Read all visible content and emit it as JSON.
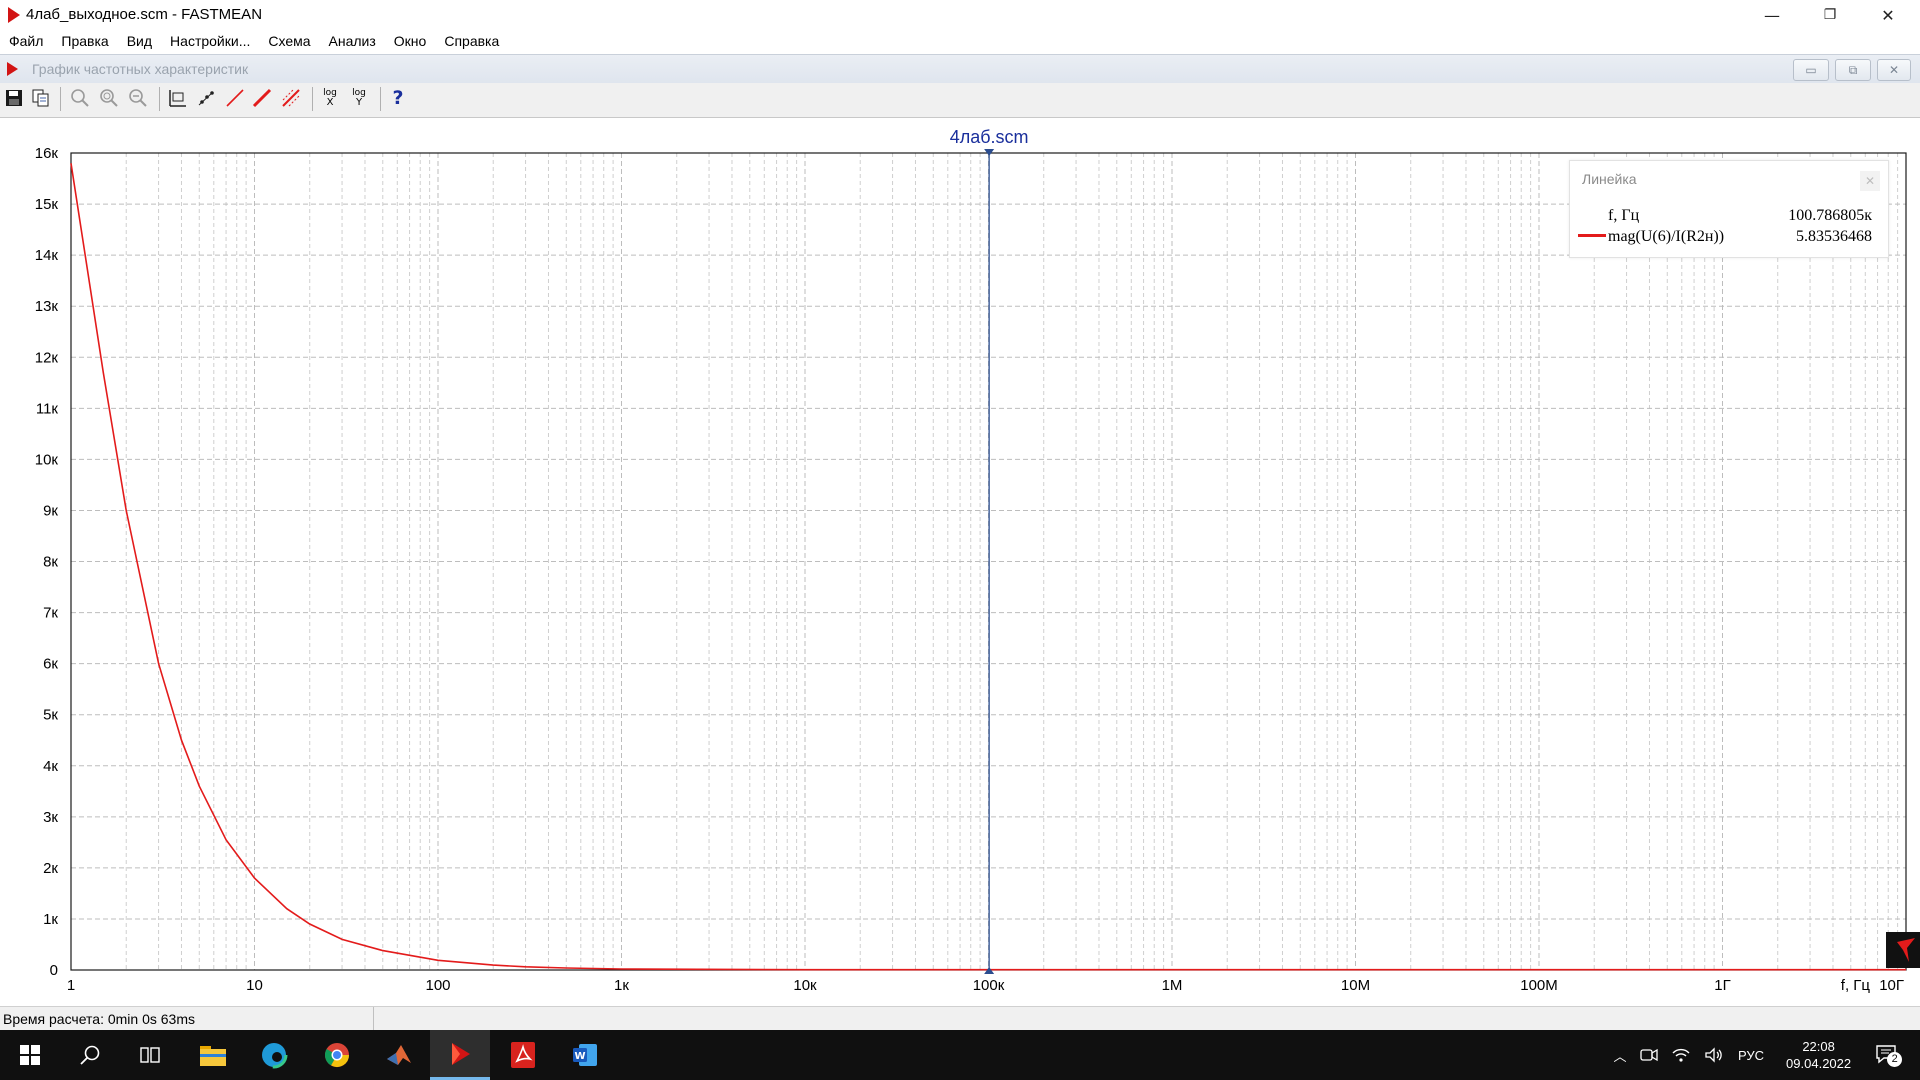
{
  "window": {
    "title": "4лаб_выходное.scm - FASTMEAN",
    "minimize": "—",
    "maximize": "❐",
    "close": "✕"
  },
  "menu": [
    "Файл",
    "Правка",
    "Вид",
    "Настройки...",
    "Схема",
    "Анализ",
    "Окно",
    "Справка"
  ],
  "subwindow": {
    "title": "График частотных характеристик",
    "min": "▭",
    "restore": "⧉",
    "close": "✕"
  },
  "toolbar": {
    "logx_top": "log",
    "logx_bottom": "X",
    "logy_top": "log",
    "logy_bottom": "Y",
    "help": "?"
  },
  "colors": {
    "curve": "#e31b1b",
    "cursor": "#2b4d8f",
    "grid": "#cfcfcf",
    "title": "#1a2f9c"
  },
  "chart_data": {
    "type": "line",
    "title": "4лаб.scm",
    "xscale": "log",
    "xlim": [
      1,
      10000000000
    ],
    "ylim": [
      0,
      16000
    ],
    "xticks": [
      {
        "v": 1,
        "label": "1"
      },
      {
        "v": 10,
        "label": "10"
      },
      {
        "v": 100,
        "label": "100"
      },
      {
        "v": 1000,
        "label": "1к"
      },
      {
        "v": 10000,
        "label": "10к"
      },
      {
        "v": 100000,
        "label": "100к"
      },
      {
        "v": 1000000,
        "label": "1М"
      },
      {
        "v": 10000000,
        "label": "10М"
      },
      {
        "v": 100000000,
        "label": "100М"
      },
      {
        "v": 1000000000,
        "label": "1Г"
      },
      {
        "v": 10000000000,
        "label": "10Г"
      }
    ],
    "yticks": [
      {
        "v": 0,
        "label": "0"
      },
      {
        "v": 1000,
        "label": "1к"
      },
      {
        "v": 2000,
        "label": "2к"
      },
      {
        "v": 3000,
        "label": "3к"
      },
      {
        "v": 4000,
        "label": "4к"
      },
      {
        "v": 5000,
        "label": "5к"
      },
      {
        "v": 6000,
        "label": "6к"
      },
      {
        "v": 7000,
        "label": "7к"
      },
      {
        "v": 8000,
        "label": "8к"
      },
      {
        "v": 9000,
        "label": "9к"
      },
      {
        "v": 10000,
        "label": "10к"
      },
      {
        "v": 11000,
        "label": "11к"
      },
      {
        "v": 12000,
        "label": "12к"
      },
      {
        "v": 13000,
        "label": "13к"
      },
      {
        "v": 14000,
        "label": "14к"
      },
      {
        "v": 15000,
        "label": "15к"
      },
      {
        "v": 16000,
        "label": "16к"
      }
    ],
    "xlabel": "f, Гц",
    "grid": true,
    "series": [
      {
        "name": "mag(U(6)/I(R2н))",
        "x": [
          1,
          1.5,
          2,
          3,
          4,
          5,
          7,
          10,
          15,
          20,
          30,
          50,
          100,
          200,
          300,
          500,
          1000,
          10000,
          100000,
          1000000,
          10000000,
          100000000,
          1000000000,
          10000000000
        ],
        "y": [
          15800,
          11700,
          9000,
          6000,
          4500,
          3600,
          2550,
          1800,
          1200,
          900,
          600,
          380,
          190,
          95,
          63,
          40,
          20,
          6,
          5.8,
          5.8,
          5.8,
          5.8,
          5.8,
          5.8
        ]
      }
    ],
    "cursor": {
      "x": 100786.805,
      "y": 5.83536468
    },
    "legend": {
      "title": "Линейка",
      "x_name": "f, Гц",
      "x_value": "100.786805к",
      "y_name": "mag(U(6)/I(R2н))",
      "y_value": "5.83536468"
    }
  },
  "status": {
    "calc_time": "Время расчета: 0min 0s 63ms"
  },
  "taskbar": {
    "lang": "РУС",
    "time": "22:08",
    "date": "09.04.2022",
    "notifications": "2"
  }
}
